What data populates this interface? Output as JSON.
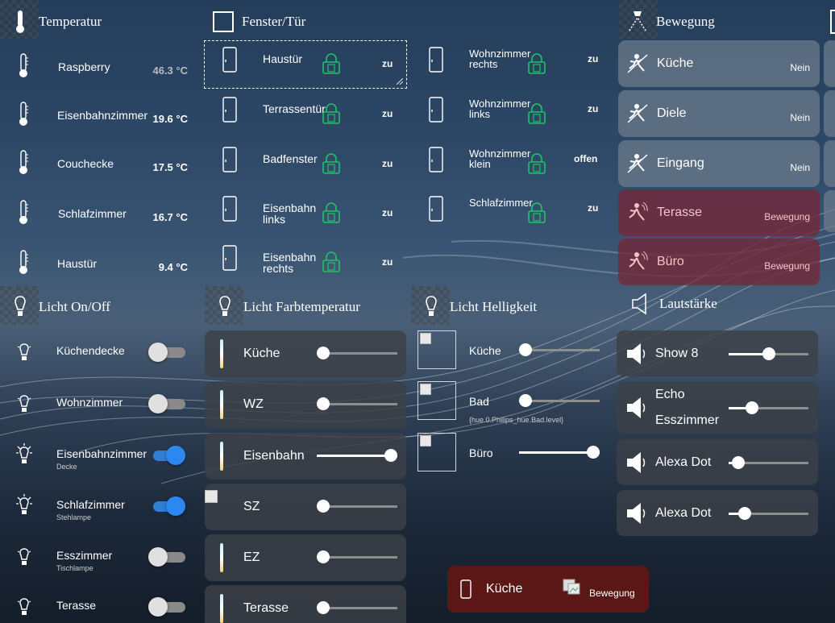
{
  "sections": {
    "temperatur": "Temperatur",
    "fenster": "Fenster/Tür",
    "bewegung": "Bewegung",
    "licht_onoff": "Licht On/Off",
    "licht_farb": "Licht Farbtemperatur",
    "licht_hell": "Licht Helligkeit",
    "laut": "Lautstärke"
  },
  "temperature": [
    {
      "name": "Raspberry",
      "value": "46.3 °C"
    },
    {
      "name": "Eisenbahnzimmer",
      "value": "19.6 °C"
    },
    {
      "name": "Couchecke",
      "value": "17.5 °C"
    },
    {
      "name": "Schlafzimmer",
      "value": "16.7 °C"
    },
    {
      "name": "Haustür",
      "value": "9.4 °C"
    }
  ],
  "windows_left": [
    {
      "name": "Haustür",
      "state": "zu"
    },
    {
      "name": "Terrassentür",
      "state": "zu"
    },
    {
      "name": "Badfenster",
      "state": "zu"
    },
    {
      "name": "Eisenbahn links",
      "state": "zu"
    },
    {
      "name": "Eisenbahn rechts",
      "state": "zu"
    }
  ],
  "windows_right": [
    {
      "name": "Wohnzimmer rechts",
      "state": "zu"
    },
    {
      "name": "Wohnzimmer links",
      "state": "zu"
    },
    {
      "name": "Wohnzimmer klein",
      "state": "offen"
    },
    {
      "name": "Schlafzimmer",
      "state": "zu"
    }
  ],
  "motion": [
    {
      "name": "Küche",
      "state": "Nein",
      "alarm": false
    },
    {
      "name": "Diele",
      "state": "Nein",
      "alarm": false
    },
    {
      "name": "Eingang",
      "state": "Nein",
      "alarm": false
    },
    {
      "name": "Terasse",
      "state": "Bewegung",
      "alarm": true
    },
    {
      "name": "Büro",
      "state": "Bewegung",
      "alarm": true
    }
  ],
  "lights_onoff": [
    {
      "name": "Küchendecke",
      "sub": "",
      "on": false
    },
    {
      "name": "Wohnzimmer",
      "sub": "",
      "on": false
    },
    {
      "name": "Eisenbahnzimmer",
      "sub": "Decke",
      "on": true
    },
    {
      "name": "Schlafzimmer",
      "sub": "Stehlampe",
      "on": true
    },
    {
      "name": "Esszimmer",
      "sub": "Tischlampe",
      "on": false
    },
    {
      "name": "Terasse",
      "sub": "",
      "on": false
    }
  ],
  "lights_colortemp": [
    {
      "name": "Küche",
      "level": 0
    },
    {
      "name": "WZ",
      "level": 0
    },
    {
      "name": "Eisenbahn",
      "level": 1
    },
    {
      "name": "SZ",
      "level": 0
    },
    {
      "name": "EZ",
      "level": 0
    },
    {
      "name": "Terasse",
      "level": 0
    }
  ],
  "lights_brightness": [
    {
      "name": "Küche",
      "level": 0,
      "note": ""
    },
    {
      "name": "Bad",
      "level": 0,
      "note": "{hue.0.Philips_hue.Bad.level}"
    },
    {
      "name": "Büro",
      "level": 1,
      "note": ""
    }
  ],
  "volume": [
    {
      "name": "Show 8",
      "level": 0.5
    },
    {
      "name": "Echo Esszimmer",
      "line1": "Echo",
      "line2": "Esszimmer",
      "level": 0.25
    },
    {
      "name": "Alexa Dot",
      "level": 0.05
    },
    {
      "name": "Alexa Dot",
      "level": 0.15
    }
  ],
  "bottom_card": {
    "name": "Küche",
    "state": "Bewegung"
  },
  "colors": {
    "lock": "#22c268",
    "toggle_on": "#2c88f0",
    "alarm_card": "#732837",
    "bottom_card": "#5b1616"
  }
}
